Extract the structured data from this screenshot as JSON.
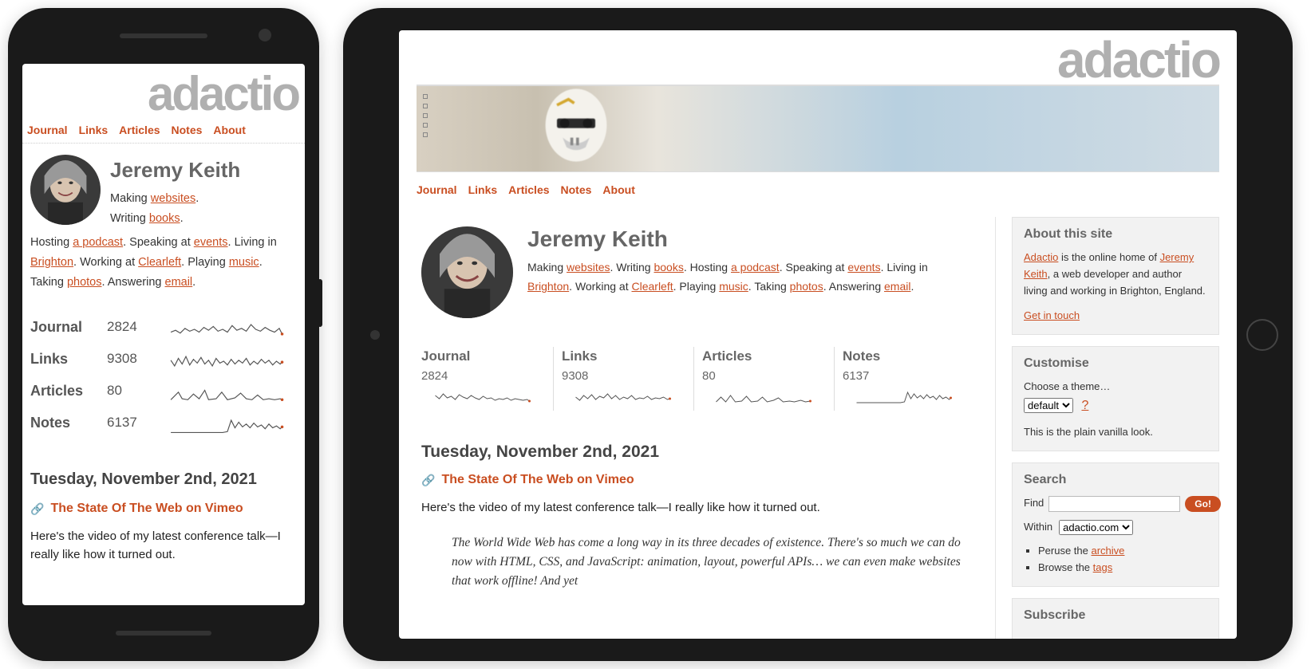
{
  "site": {
    "logo": "adactio"
  },
  "nav": {
    "journal": "Journal",
    "links": "Links",
    "articles": "Articles",
    "notes": "Notes",
    "about": "About"
  },
  "author": {
    "name": "Jeremy Keith",
    "bio": {
      "making": "Making ",
      "websites": "websites",
      "period1": ". ",
      "writing": "Writing ",
      "books": "books",
      "period2": ". ",
      "hosting": "Hosting ",
      "podcast": "a podcast",
      "period3": ". ",
      "speaking": "Speaking at ",
      "events": "events",
      "period4": ". ",
      "living": "Living in ",
      "brighton": "Brighton",
      "period5": ". ",
      "working": "Working at ",
      "clearleft": "Clearleft",
      "period6": ". ",
      "playing": "Playing ",
      "music": "music",
      "period7": ". ",
      "taking": "Taking ",
      "photos": "photos",
      "period8": ". ",
      "answering": "Answering ",
      "email": "email",
      "period9": "."
    }
  },
  "stats": {
    "journal": {
      "label": "Journal",
      "count": "2824"
    },
    "links": {
      "label": "Links",
      "count": "9308"
    },
    "articles": {
      "label": "Articles",
      "count": "80"
    },
    "notes": {
      "label": "Notes",
      "count": "6137"
    }
  },
  "post": {
    "date": "Tuesday, November 2nd, 2021",
    "title": "The State Of The Web on Vimeo",
    "intro": "Here's the video of my latest conference talk—I really like how it turned out.",
    "quote": "The World Wide Web has come a long way in its three decades of existence. There's so much we can do now with HTML, CSS, and JavaScript: animation, layout, powerful APIs… we can even make websites that work offline! And yet"
  },
  "sidebar": {
    "about": {
      "heading": "About this site",
      "p1a": "Adactio",
      "p1b": " is the online home of ",
      "p1c": "Jeremy Keith",
      "p1d": ", a web developer and author living and working in Brighton, England.",
      "contact": "Get in touch"
    },
    "customise": {
      "heading": "Customise",
      "choose": "Choose a theme…",
      "selected": "default",
      "help": "?",
      "desc": "This is the plain vanilla look."
    },
    "search": {
      "heading": "Search",
      "find": "Find",
      "go": "Go!",
      "within": "Within",
      "scope": "adactio.com",
      "peruse_a": "Peruse the ",
      "peruse_b": "archive",
      "browse_a": "Browse the ",
      "browse_b": "tags"
    },
    "subscribe": {
      "heading": "Subscribe"
    }
  }
}
